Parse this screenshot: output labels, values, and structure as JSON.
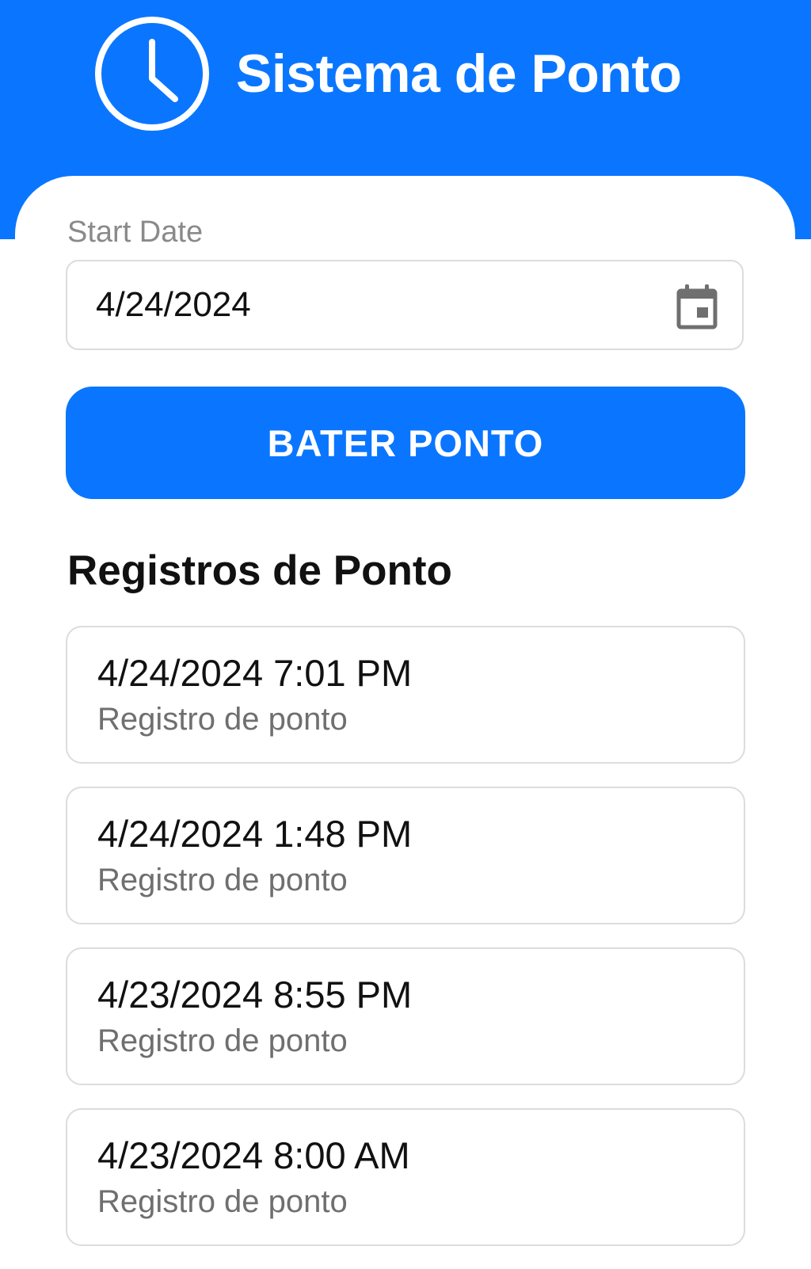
{
  "header": {
    "title": "Sistema de Ponto",
    "icon": "clock-icon",
    "background_color": "#0a76ff"
  },
  "form": {
    "start_date_label": "Start Date",
    "start_date_value": "4/24/2024",
    "calendar_icon": "calendar-icon"
  },
  "actions": {
    "punch_button_label": "BATER PONTO",
    "accent_color": "#0a76ff"
  },
  "records": {
    "section_title": "Registros de Ponto",
    "items": [
      {
        "time": "4/24/2024 7:01 PM",
        "description": "Registro de ponto"
      },
      {
        "time": "4/24/2024 1:48 PM",
        "description": "Registro de ponto"
      },
      {
        "time": "4/23/2024 8:55 PM",
        "description": "Registro de ponto"
      },
      {
        "time": "4/23/2024 8:00 AM",
        "description": "Registro de ponto"
      }
    ]
  }
}
